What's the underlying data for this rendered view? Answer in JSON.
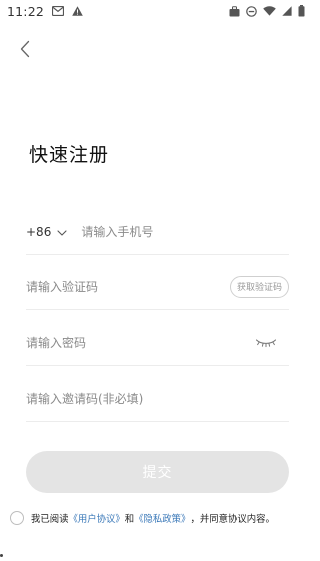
{
  "status_bar": {
    "time": "11:22",
    "left_icons": [
      "mail-icon",
      "warning-icon"
    ],
    "right_icons": [
      "briefcase-icon",
      "do-not-disturb-icon",
      "wifi-icon",
      "cell-signal-icon",
      "battery-icon"
    ]
  },
  "header": {
    "back_icon": "chevron-left-icon"
  },
  "page": {
    "title": "快速注册"
  },
  "form": {
    "country_code": "+86",
    "phone_placeholder": "请输入手机号",
    "code_placeholder": "请输入验证码",
    "get_code_label": "获取验证码",
    "password_placeholder": "请输入密码",
    "invite_placeholder": "请输入邀请码(非必填)",
    "submit_label": "提交"
  },
  "agreement": {
    "prefix": "我已阅读",
    "user_agreement": "《用户协议》",
    "and": "和",
    "privacy_policy": "《隐私政策》",
    "suffix": "，并同意协议内容。"
  },
  "colors": {
    "link": "#3a78b8",
    "submit_disabled": "#e4e4e4",
    "divider": "#ececec"
  }
}
